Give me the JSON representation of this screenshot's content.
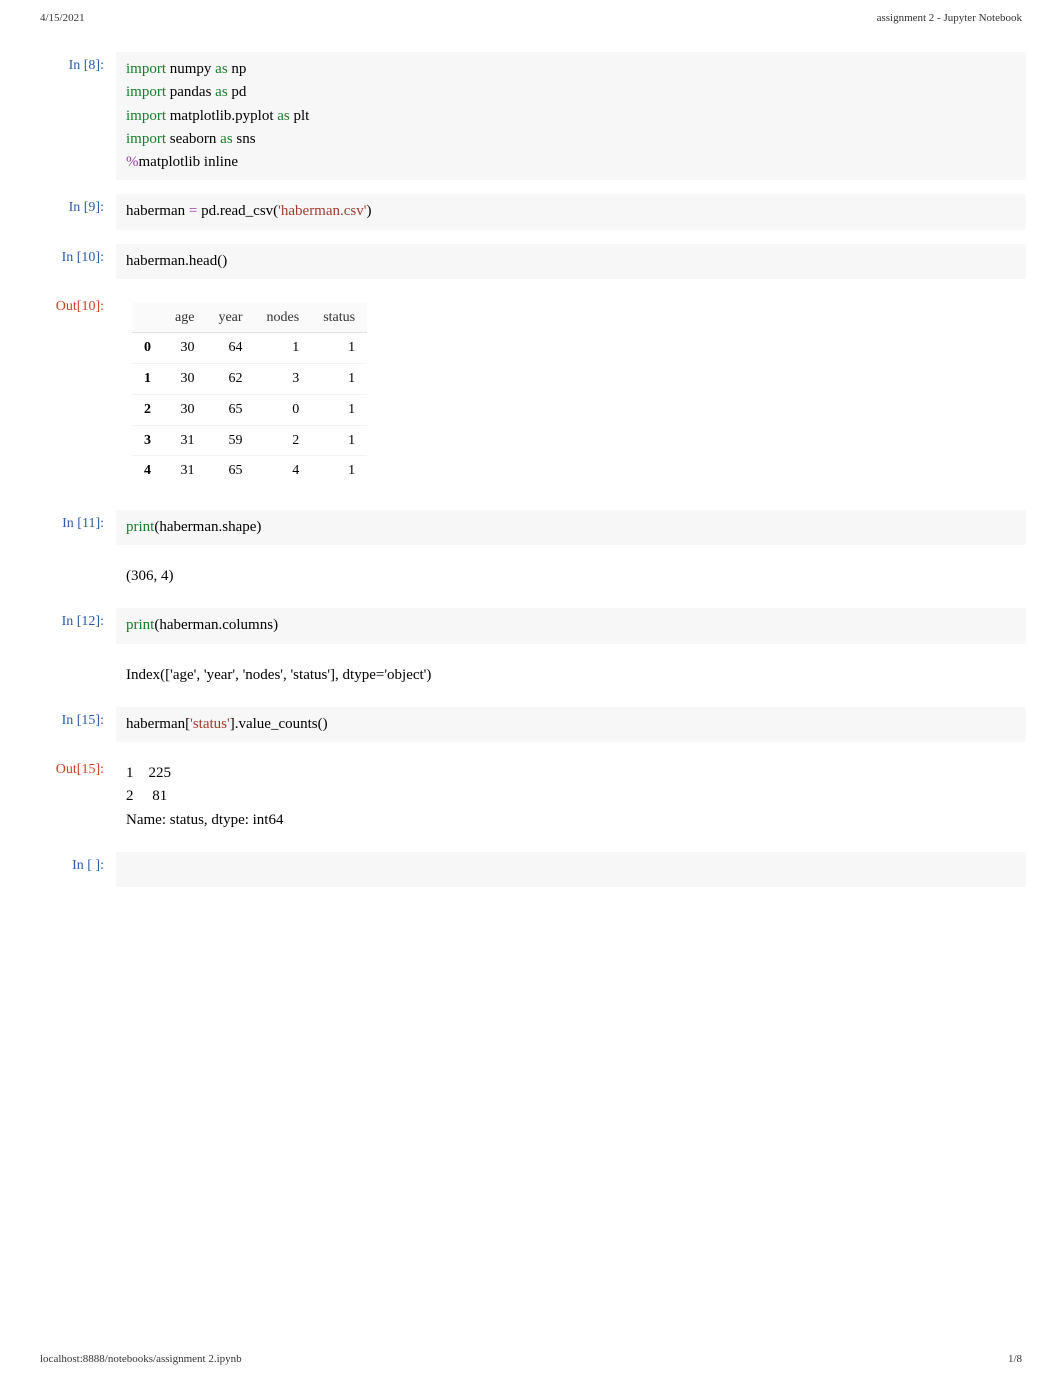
{
  "header": {
    "date": "4/15/2021",
    "title": "assignment 2 - Jupyter Notebook"
  },
  "prompts": {
    "in8": "In [8]:",
    "in9": "In [9]:",
    "in10": "In [10]:",
    "out10": "Out[10]:",
    "in11": "In [11]:",
    "in12": "In [12]:",
    "in15": "In [15]:",
    "out15": "Out[15]:",
    "inEmpty": "In [ ]:"
  },
  "code": {
    "c8": {
      "lines": [
        {
          "tokens": [
            {
              "t": "import ",
              "cls": "kw"
            },
            {
              "t": "numpy ",
              "cls": ""
            },
            {
              "t": "as ",
              "cls": "kw"
            },
            {
              "t": "np",
              "cls": ""
            }
          ]
        },
        {
          "tokens": [
            {
              "t": "import ",
              "cls": "kw"
            },
            {
              "t": "pandas ",
              "cls": ""
            },
            {
              "t": "as ",
              "cls": "kw"
            },
            {
              "t": "pd",
              "cls": ""
            }
          ]
        },
        {
          "tokens": [
            {
              "t": "import ",
              "cls": "kw"
            },
            {
              "t": "matplotlib.pyplot ",
              "cls": ""
            },
            {
              "t": "as ",
              "cls": "kw"
            },
            {
              "t": "plt",
              "cls": ""
            }
          ]
        },
        {
          "tokens": [
            {
              "t": "import ",
              "cls": "kw"
            },
            {
              "t": "seaborn ",
              "cls": ""
            },
            {
              "t": "as ",
              "cls": "kw"
            },
            {
              "t": "sns",
              "cls": ""
            }
          ]
        },
        {
          "tokens": [
            {
              "t": "%",
              "cls": "op"
            },
            {
              "t": "matplotlib inline",
              "cls": ""
            }
          ]
        }
      ]
    },
    "c9": {
      "tokens": [
        {
          "t": "haberman ",
          "cls": ""
        },
        {
          "t": "= ",
          "cls": "op"
        },
        {
          "t": "pd.read_csv",
          "cls": ""
        },
        {
          "t": "(",
          "cls": ""
        },
        {
          "t": "'haberman.csv'",
          "cls": "str"
        },
        {
          "t": ")",
          "cls": ""
        }
      ]
    },
    "c10": {
      "tokens": [
        {
          "t": "haberman.head",
          "cls": ""
        },
        {
          "t": "()",
          "cls": ""
        }
      ]
    },
    "c11": {
      "tokens": [
        {
          "t": "print",
          "cls": "builtin"
        },
        {
          "t": "(",
          "cls": ""
        },
        {
          "t": "haberman.shape",
          "cls": ""
        },
        {
          "t": ")",
          "cls": ""
        }
      ]
    },
    "c12": {
      "tokens": [
        {
          "t": "print",
          "cls": "builtin"
        },
        {
          "t": "(",
          "cls": ""
        },
        {
          "t": "haberman.columns",
          "cls": ""
        },
        {
          "t": ")",
          "cls": ""
        }
      ]
    },
    "c15": {
      "tokens": [
        {
          "t": "haberman[",
          "cls": ""
        },
        {
          "t": "'status'",
          "cls": "str"
        },
        {
          "t": "].value_counts()",
          "cls": ""
        }
      ]
    }
  },
  "table": {
    "columns": [
      "age",
      "year",
      "nodes",
      "status"
    ],
    "rows": [
      {
        "idx": "0",
        "cells": [
          "30",
          "64",
          "1",
          "1"
        ]
      },
      {
        "idx": "1",
        "cells": [
          "30",
          "62",
          "3",
          "1"
        ]
      },
      {
        "idx": "2",
        "cells": [
          "30",
          "65",
          "0",
          "1"
        ]
      },
      {
        "idx": "3",
        "cells": [
          "31",
          "59",
          "2",
          "1"
        ]
      },
      {
        "idx": "4",
        "cells": [
          "31",
          "65",
          "4",
          "1"
        ]
      }
    ]
  },
  "outputs": {
    "o11": "(306, 4)",
    "o12": "Index(['age', 'year', 'nodes', 'status'], dtype='object')",
    "o15": "1    225\n2     81\nName: status, dtype: int64"
  },
  "footer": {
    "url": "localhost:8888/notebooks/assignment 2.ipynb",
    "page": "1/8"
  }
}
